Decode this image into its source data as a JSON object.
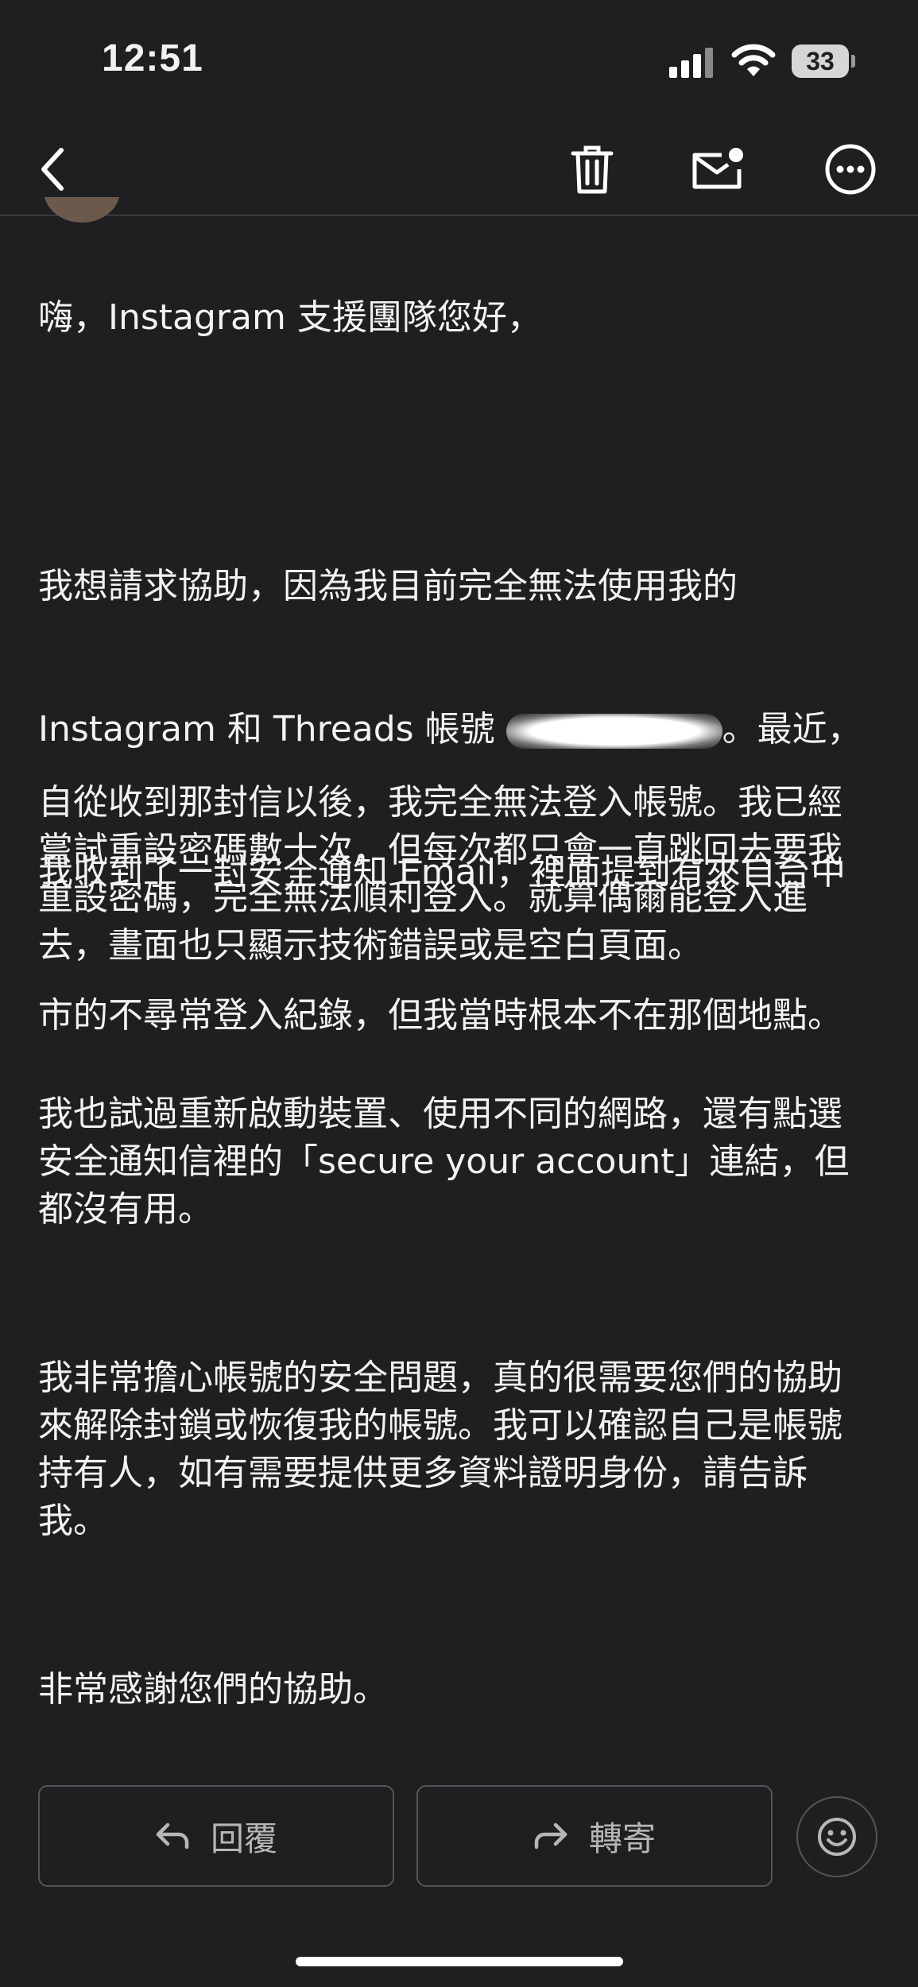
{
  "status_bar": {
    "time": "12:51",
    "battery_level": "33"
  },
  "nav": {
    "icons": [
      "back-chevron-icon",
      "trash-icon",
      "mail-unread-icon",
      "more-icon"
    ]
  },
  "email": {
    "greeting": "嗨，Instagram 支援團隊您好，",
    "para1_line1": "我想請求協助，因為我目前完全無法使用我的",
    "para1_line2_a": "Instagram 和 Threads 帳號 ",
    "para1_line2_b": "。最近，",
    "para1_line3": "我收到了一封安全通知 Email，裡面提到有來自台中",
    "para1_line4": "市的不尋常登入紀錄，但我當時根本不在那個地點。",
    "para2": "自從收到那封信以後，我完全無法登入帳號。我已經\n嘗試重設密碼數十次，但每次都只會一直跳回去要我\n重設密碼，完全無法順利登入。就算偶爾能登入進\n去，畫面也只顯示技術錯誤或是空白頁面。",
    "para3": "我也試過重新啟動裝置、使用不同的網路，還有點選\n安全通知信裡的「secure your account」連結，但\n都沒有用。",
    "para4": "我非常擔心帳號的安全問題，真的很需要您們的協助\n來解除封鎖或恢復我的帳號。我可以確認自己是帳號\n持有人，如有需要提供更多資料證明身份，請告訴\n我。",
    "closing": "非常感謝您們的協助。"
  },
  "actions": {
    "reply_label": "回覆",
    "forward_label": "轉寄"
  }
}
